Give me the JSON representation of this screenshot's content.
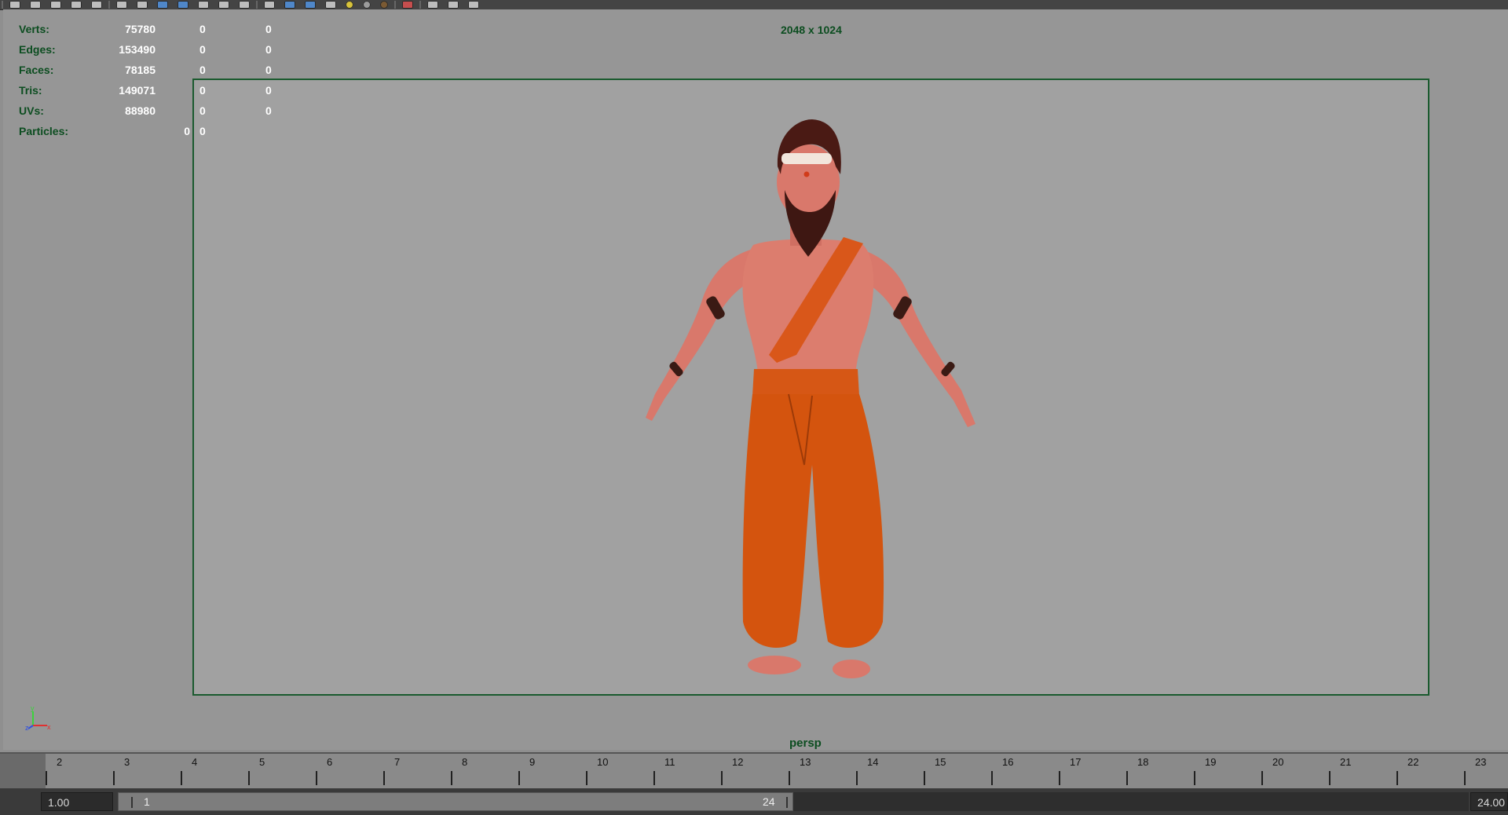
{
  "hud": {
    "rows": [
      {
        "label": "Verts:",
        "v1": "75780",
        "v2": "0",
        "v3": "0"
      },
      {
        "label": "Edges:",
        "v1": "153490",
        "v2": "0",
        "v3": "0"
      },
      {
        "label": "Faces:",
        "v1": "78185",
        "v2": "0",
        "v3": "0"
      },
      {
        "label": "Tris:",
        "v1": "149071",
        "v2": "0",
        "v3": "0"
      },
      {
        "label": "UVs:",
        "v1": "88980",
        "v2": "0",
        "v3": "0"
      }
    ],
    "particles": {
      "label": "Particles:",
      "v1": "0",
      "v2": "0"
    }
  },
  "viewport": {
    "resolution": "2048 x 1024",
    "camera": "persp",
    "background": "#969696",
    "gate_color": "#1a5a2e"
  },
  "axis": {
    "y": "y",
    "z": "z",
    "x": "x"
  },
  "timeline": {
    "ticks": [
      "2",
      "3",
      "4",
      "5",
      "6",
      "7",
      "8",
      "9",
      "10",
      "11",
      "12",
      "13",
      "14",
      "15",
      "16",
      "17",
      "18",
      "19",
      "20",
      "21",
      "22",
      "23"
    ]
  },
  "range": {
    "current_time": "1.00",
    "start": "1",
    "end": "24",
    "end_time": "24.00"
  },
  "toolbar": {
    "icons": [
      "select-tool-icon",
      "lasso-tool-icon",
      "paint-tool-icon",
      "move-tool-icon",
      "rotate-tool-icon",
      "scale-tool-icon",
      "camera-icon",
      "bookmark-icon",
      "grid-icon",
      "film-gate-icon",
      "resolution-gate-icon",
      "gate-mask-icon",
      "field-chart-icon",
      "safe-action-icon",
      "safe-title-icon",
      "wireframe-icon",
      "smooth-shade-icon",
      "shaded-wireframe-icon",
      "textured-icon",
      "use-all-lights-icon",
      "shadows-icon",
      "ambient-occlusion-icon",
      "anti-aliasing-icon",
      "xray-icon",
      "isolate-select-icon",
      "xray-joints-icon",
      "hud-icon"
    ]
  }
}
